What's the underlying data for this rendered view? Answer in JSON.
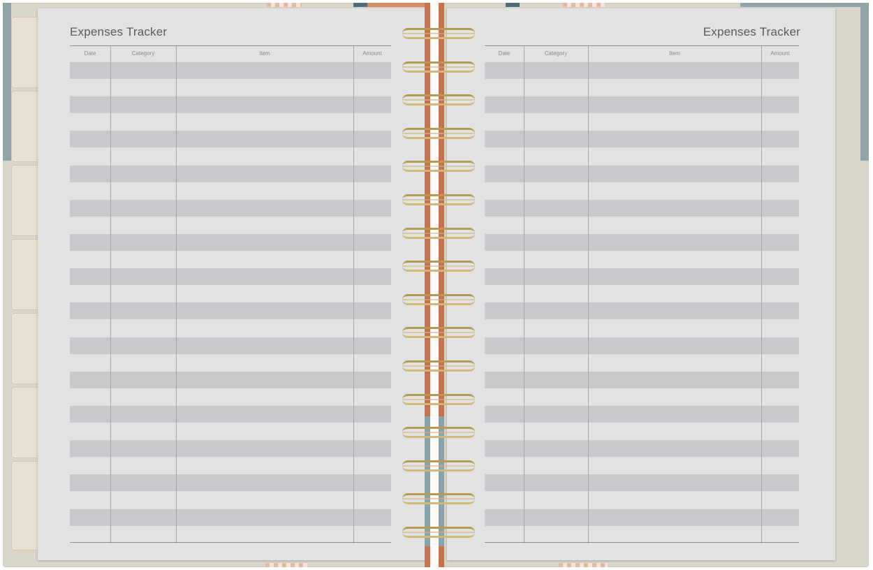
{
  "left_page": {
    "title": "Expenses Tracker",
    "columns": [
      "Date",
      "Category",
      "Item",
      "Amount"
    ]
  },
  "right_page": {
    "title": "Expenses Tracker",
    "columns": [
      "Date",
      "Category",
      "Item",
      "Amount"
    ]
  },
  "colors": {
    "page": "#e2e2e2",
    "row_stripe": "#c7c9cc",
    "spine_orange": "#c9714e",
    "spine_blue": "#8aa2aa",
    "rings": "#cfb878",
    "cover": "#d9d6c9"
  }
}
